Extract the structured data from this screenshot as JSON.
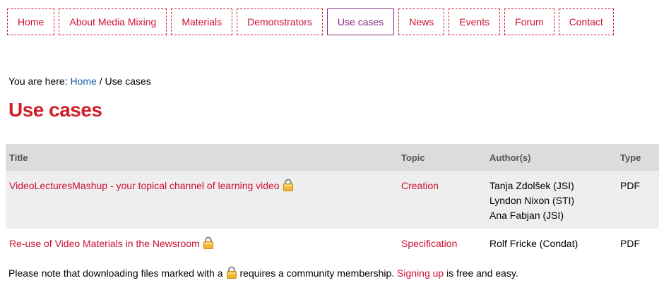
{
  "nav": {
    "items": [
      "Home",
      "About Media Mixing",
      "Materials",
      "Demonstrators",
      "Use cases",
      "News",
      "Events",
      "Forum",
      "Contact"
    ],
    "active": "Use cases"
  },
  "breadcrumb": {
    "prefix": "You are here:",
    "home": "Home",
    "separator": "/",
    "current": "Use cases"
  },
  "page_title": "Use cases",
  "table": {
    "headers": {
      "title": "Title",
      "topic": "Topic",
      "authors": "Author(s)",
      "type": "Type"
    },
    "rows": [
      {
        "title": "VideoLecturesMashup - your topical channel of learning video",
        "topic": "Creation",
        "authors": [
          "Tanja Zdolšek (JSI)",
          "Lyndon Nixon (STI)",
          "Ana Fabjan (JSI)"
        ],
        "type": "PDF",
        "locked": true
      },
      {
        "title": "Re-use of Video Materials in the Newsroom",
        "topic": "Specification",
        "authors": [
          "Rolf Fricke (Condat)"
        ],
        "type": "PDF",
        "locked": true
      }
    ]
  },
  "note": {
    "before_icon": "Please note that downloading files marked with a",
    "after_icon": "requires a community membership.",
    "link": "Signing up",
    "after_link": "is free and easy."
  },
  "icons": {
    "lock": "lock-icon"
  },
  "colors": {
    "accent": "#d01f2b",
    "active_nav": "#8a2b84",
    "link_blue": "#1a5fa8"
  }
}
